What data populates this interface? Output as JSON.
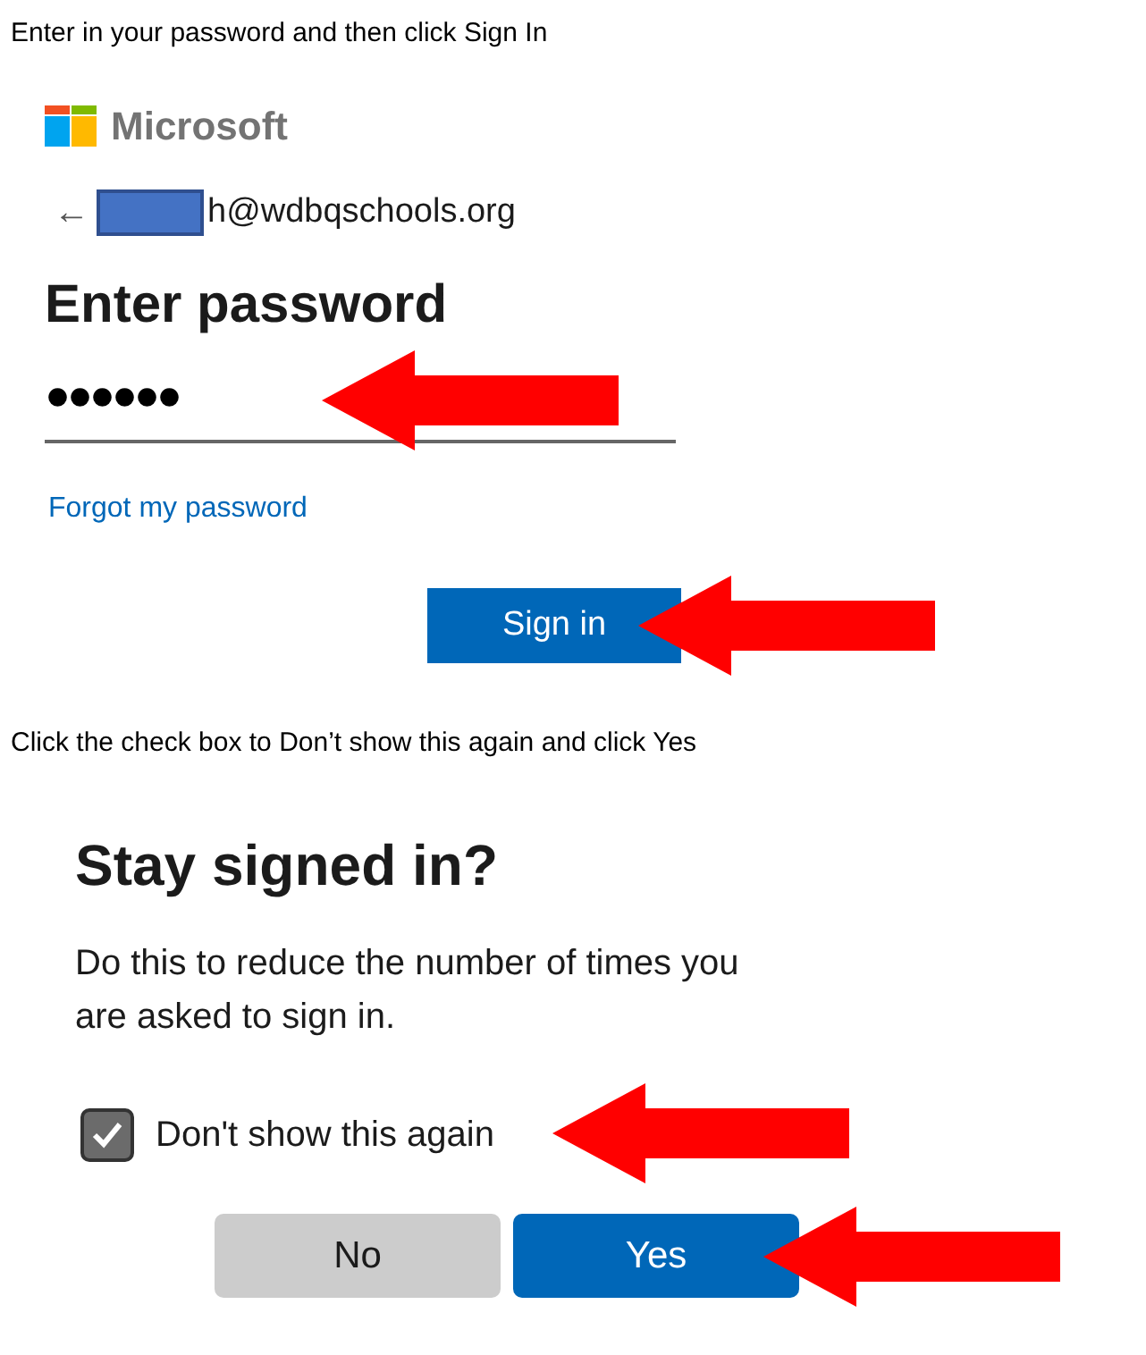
{
  "step1": {
    "instruction": "Enter in your password and then click Sign In",
    "brand": "Microsoft",
    "back_arrow": "←",
    "email": "h@wdbqschools.org",
    "heading": "Enter password",
    "password": "●●●●●●",
    "forgot_link": "Forgot my password",
    "sign_in_button": "Sign in"
  },
  "step2": {
    "instruction": "Click the check box to Don’t show this again and click Yes",
    "heading": "Stay signed in?",
    "description": "Do this to reduce the number of times you are asked to sign in.",
    "checkbox": {
      "label": "Don't show this again",
      "checked": true
    },
    "buttons": [
      {
        "label": "No",
        "kind": "secondary"
      },
      {
        "label": "Yes",
        "kind": "primary"
      }
    ]
  }
}
